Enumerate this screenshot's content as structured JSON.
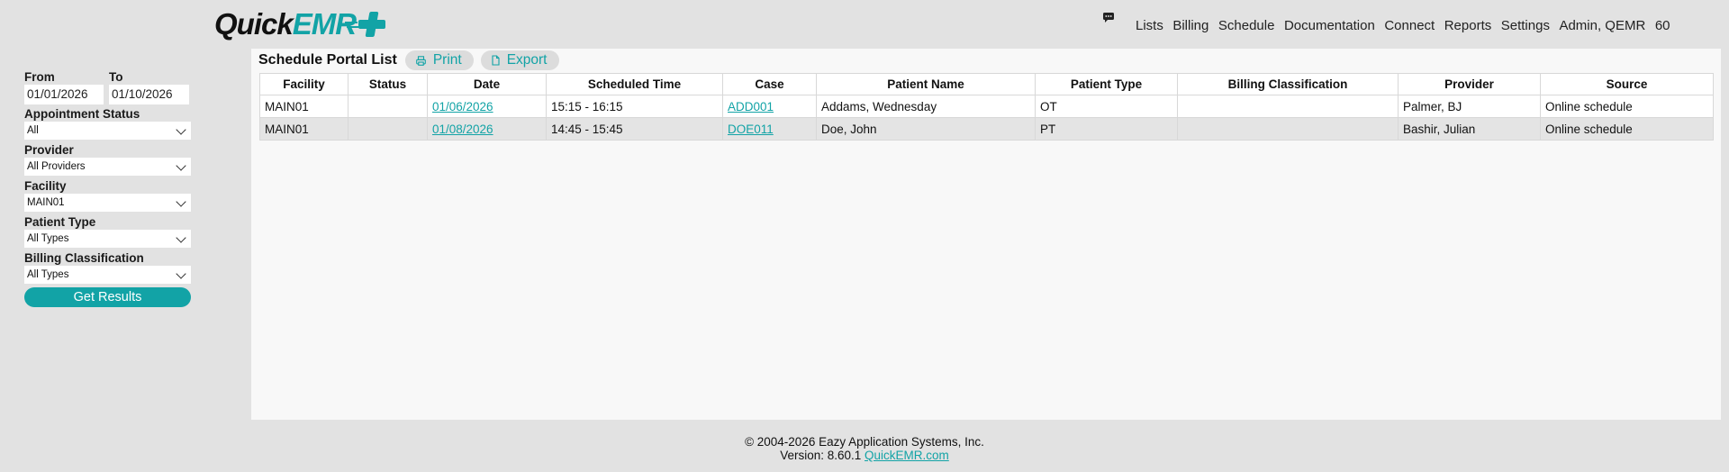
{
  "brand": {
    "logo_part1": "Quick",
    "logo_part2": "EMR",
    "accent": "#12a3a6"
  },
  "header": {
    "chat_icon": "speech-bubble-icon",
    "nav": [
      "Lists",
      "Billing",
      "Schedule",
      "Documentation",
      "Connect",
      "Reports",
      "Settings",
      "Admin, QEMR",
      "60"
    ]
  },
  "filters": {
    "from_label": "From",
    "from_value": "01/01/2026",
    "to_label": "To",
    "to_value": "01/10/2026",
    "appointment_status_label": "Appointment Status",
    "appointment_status_value": "All",
    "provider_label": "Provider",
    "provider_value": "All Providers",
    "facility_label": "Facility",
    "facility_value": "MAIN01",
    "patient_type_label": "Patient Type",
    "patient_type_value": "All Types",
    "billing_class_label": "Billing Classification",
    "billing_class_value": "All Types",
    "submit_label": "Get Results"
  },
  "main": {
    "title": "Schedule Portal List",
    "print_label": "Print",
    "export_label": "Export",
    "columns": [
      "Facility",
      "Status",
      "Date",
      "Scheduled Time",
      "Case",
      "Patient Name",
      "Patient Type",
      "Billing Classification",
      "Provider",
      "Source"
    ],
    "rows": [
      {
        "facility": "MAIN01",
        "status": "",
        "date": "01/06/2026",
        "time": "15:15 - 16:15",
        "case": "ADD001",
        "patient": "Addams, Wednesday",
        "patient_type": "OT",
        "billing": "",
        "provider": "Palmer, BJ",
        "source": "Online schedule"
      },
      {
        "facility": "MAIN01",
        "status": "",
        "date": "01/08/2026",
        "time": "14:45 - 15:45",
        "case": "DOE011",
        "patient": "Doe, John",
        "patient_type": "PT",
        "billing": "",
        "provider": "Bashir, Julian",
        "source": "Online schedule"
      }
    ]
  },
  "footer": {
    "copyright": "© 2004-2026 Eazy Application Systems, Inc.",
    "version": "Version: 8.60.1",
    "link": "QuickEMR.com"
  }
}
